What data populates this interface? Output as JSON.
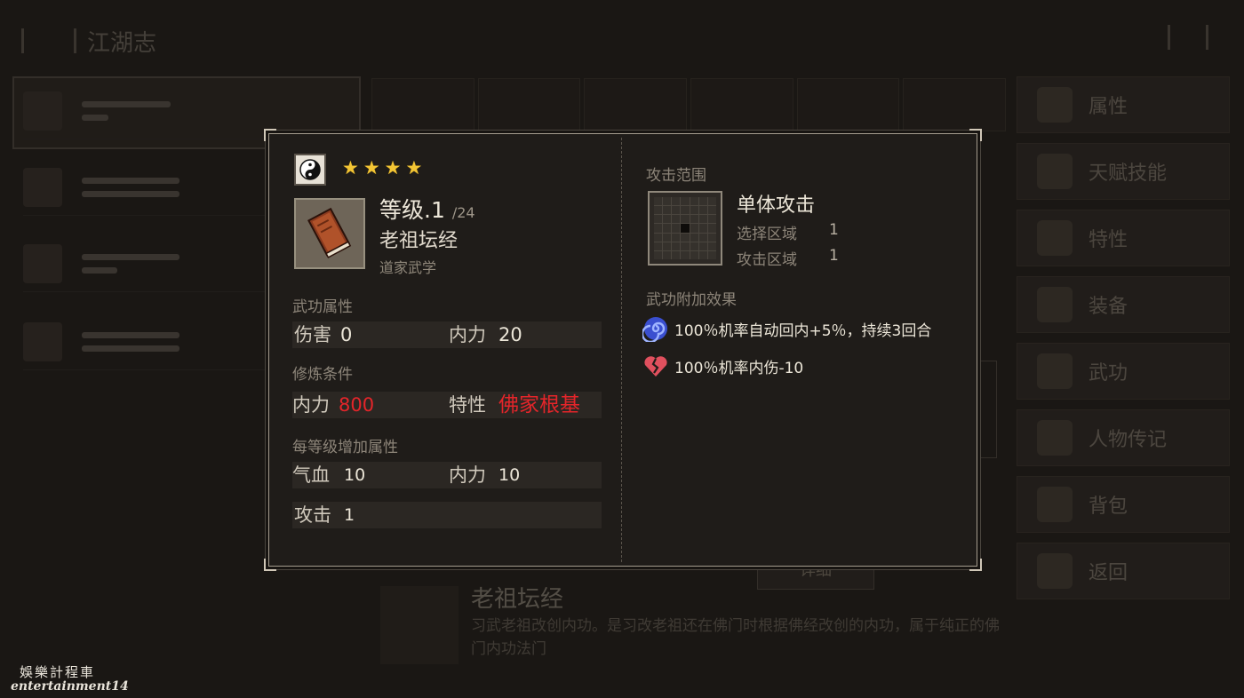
{
  "background": {
    "title": "江湖志",
    "side_menu": [
      "属性",
      "天赋技能",
      "特性",
      "装备",
      "武功",
      "人物传记",
      "背包",
      "返回"
    ],
    "detail_button": "详细",
    "bottom": {
      "name": "老祖坛经",
      "description": "习武老祖改创内功。是习改老祖还在佛门时根据佛经改创的内功，属于纯正的佛门内功法门"
    }
  },
  "tooltip": {
    "icon": "yin-yang-icon",
    "stars": [
      "★",
      "★",
      "★",
      "★"
    ],
    "star_color": "#f3c534",
    "level_label": "等级.1",
    "level_max": "/24",
    "skill_name": "老祖坛经",
    "skill_school": "道家武学",
    "martial_attrs": {
      "title": "武功属性",
      "damage_label": "伤害",
      "damage_value": "0",
      "inner_label": "内力",
      "inner_value": "20"
    },
    "requirements": {
      "title": "修炼条件",
      "inner_label": "内力",
      "inner_value": "800",
      "trait_label": "特性",
      "trait_value": "佛家根基",
      "warning_color": "#e4252a"
    },
    "per_level": {
      "title": "每等级增加属性",
      "hp_label": "气血",
      "hp_value": "10",
      "inner_label": "内力",
      "inner_value": "10",
      "attack_label": "攻击",
      "attack_value": "1"
    },
    "attack_range": {
      "title": "攻击范围",
      "name": "单体攻击",
      "select_label": "选择区域",
      "select_value": "1",
      "attack_label": "攻击区域",
      "attack_value": "1"
    },
    "extra_effects": {
      "title": "武功附加效果",
      "items": [
        {
          "icon": "swirl-icon",
          "text": "100％机率自动回内+5％，持续3回合"
        },
        {
          "icon": "broken-heart-icon",
          "text": "100％机率内伤-10"
        }
      ]
    }
  },
  "watermark": {
    "chinese": "娛樂計程車",
    "english": "entertainment14"
  }
}
